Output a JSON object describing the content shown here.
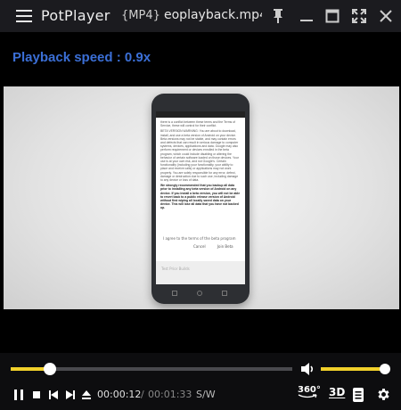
{
  "titlebar": {
    "app_name": "PotPlayer",
    "file_format": "{MP4}",
    "file_name": "eoplayback.mp4"
  },
  "osd": {
    "text": "Playback speed : 0.9x"
  },
  "video": {
    "phone_screen_paragraphs": [
      "there is a conflict between these terms and the Terms of Service, these will control for their conflict.",
      "BETA VERSION WARNING: You are about to download, install, and use a beta version of Android on your device. Beta versions may not be stable, and may contain errors and defects that can result in serious damage to computer systems, devices, applications and data. Google may also perform requirement or devices enrolled in the beta program, which could include disabling or altering the behavior of certain software loaded on those devices. Your use is at your own risk, and not Google's. Certain functionality (including your functionality, your ability to place and receive calls) or applications may not work properly. You are solely responsible for any error, defect, damage or destruction due to such use, including damage to any device or loss of data.",
      "We strongly recommended that you backup all data prior to installing any beta version of Android on any device. If you install a beta version, you will not be able to revert back to a public release version of Android without first wiping all locally saved data on your device. This will lose all data that you have not backed up."
    ],
    "phone_checkbox": "I agree to the terms of the beta program",
    "phone_cancel": "Cancel",
    "phone_join": "Join Beta",
    "phone_field": "Test Prior Builds"
  },
  "controls": {
    "time_current": "00:00:12",
    "time_separator": "/",
    "time_total": "00:01:33",
    "subtitle_toggle": "S/W",
    "btn_360": "360°",
    "btn_3d": "3D"
  },
  "playback": {
    "progress_fraction": 0.14,
    "volume_fraction": 1.0
  },
  "colors": {
    "accent": "#f1d02a",
    "osd_text": "#3b6fd6",
    "titlebar_bg": "#1b1b1f"
  },
  "icons": {
    "menu": "hamburger-menu-icon",
    "pin": "pin-icon",
    "minimize": "minimize-icon",
    "maximize": "maximize-icon",
    "fullscreen": "fullscreen-icon",
    "close": "close-icon",
    "volume": "speaker-icon",
    "pause": "pause-icon",
    "stop": "stop-icon",
    "prev": "skip-previous-icon",
    "next": "skip-next-icon",
    "eject": "eject-icon",
    "playlist": "playlist-icon",
    "settings": "gear-icon"
  }
}
